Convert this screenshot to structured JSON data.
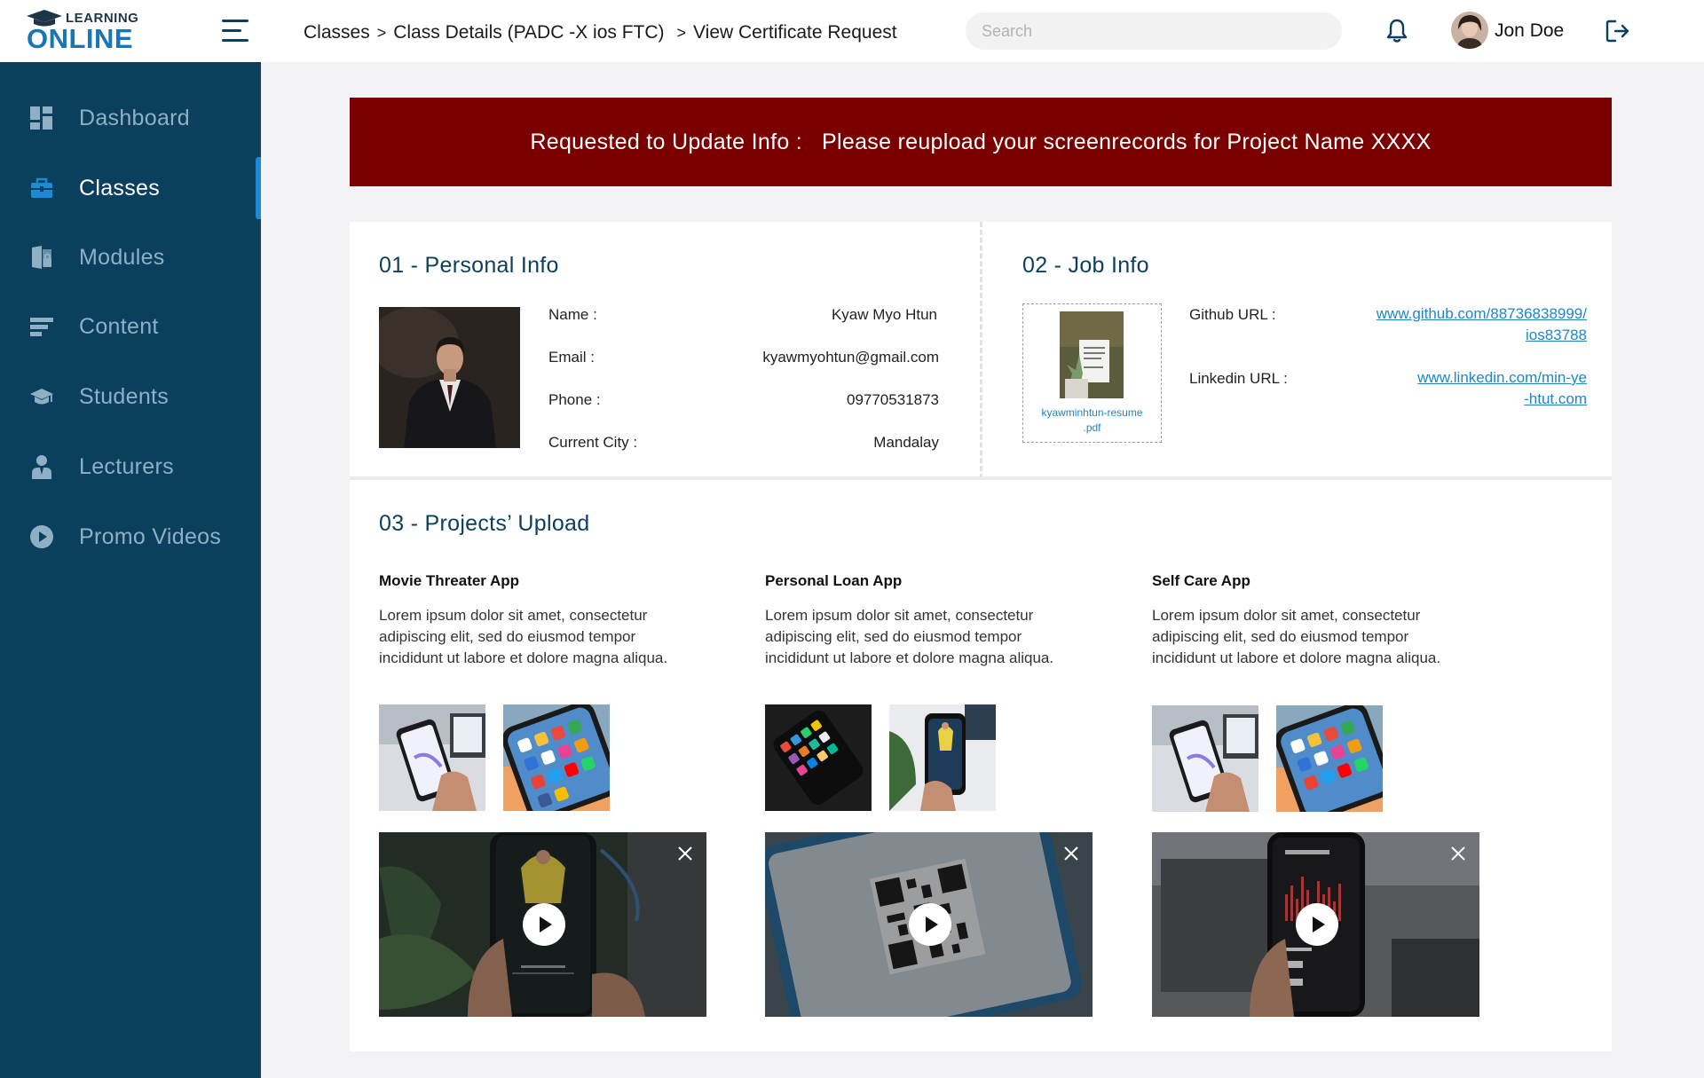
{
  "brand": {
    "top": "LEARNING",
    "bottom": "ONLINE"
  },
  "breadcrumb": {
    "item1": "Classes",
    "item2": "Class Details (PADC -X ios FTC)",
    "item3": "View Certificate Request",
    "separator": ">"
  },
  "search": {
    "placeholder": "Search"
  },
  "user": {
    "name": "Jon Doe"
  },
  "sidebar": {
    "items": [
      {
        "label": "Dashboard",
        "icon": "dashboard-icon"
      },
      {
        "label": "Classes",
        "icon": "briefcase-icon",
        "active": true
      },
      {
        "label": "Modules",
        "icon": "modules-icon"
      },
      {
        "label": "Content",
        "icon": "content-icon"
      },
      {
        "label": "Students",
        "icon": "graduation-cap-icon"
      },
      {
        "label": "Lecturers",
        "icon": "lecturer-icon"
      },
      {
        "label": "Promo Videos",
        "icon": "play-circle-icon"
      }
    ]
  },
  "banner": {
    "label": "Requested to Update Info :",
    "message": "Please reupload your screenrecords for Project Name XXXX",
    "color": "#7a0000"
  },
  "personal": {
    "title": "01 - Personal Info",
    "name_label": "Name :",
    "name": "Kyaw Myo Htun",
    "email_label": "Email :",
    "email": "kyawmyohtun@gmail.com",
    "phone_label": "Phone :",
    "phone": "09770531873",
    "city_label": "Current City :",
    "city": "Mandalay"
  },
  "job": {
    "title": "02 - Job Info",
    "resume_line1": "kyawminhtun-resume",
    "resume_line2": ".pdf",
    "github_label": "Github URL :",
    "github_line1": "www.github.com/88736838999/",
    "github_line2": "ios83788",
    "linkedin_label": "Linkedin URL :",
    "linkedin_line1": "www.linkedin.com/min-ye",
    "linkedin_line2": "-htut.com"
  },
  "projects": {
    "title": "03 - Projects’ Upload",
    "items": [
      {
        "name": "Movie Threater App",
        "desc": "Lorem ipsum dolor sit amet, consectetur adipiscing elit, sed do eiusmod tempor incididunt ut labore et dolore magna aliqua."
      },
      {
        "name": "Personal Loan App",
        "desc": "Lorem ipsum dolor sit amet, consectetur adipiscing elit, sed do eiusmod tempor incididunt ut labore et dolore magna aliqua."
      },
      {
        "name": "Self Care App",
        "desc": "Lorem ipsum dolor sit amet, consectetur adipiscing elit, sed do eiusmod tempor incididunt ut labore et dolore magna aliqua."
      }
    ]
  },
  "colors": {
    "sidebar": "#0b3f5e",
    "accent": "#1f86c8",
    "banner": "#7a0000"
  }
}
